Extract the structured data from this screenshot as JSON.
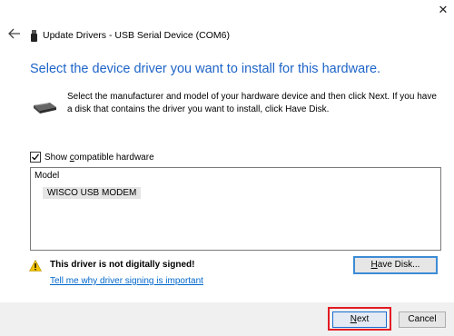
{
  "window": {
    "close_glyph": "✕"
  },
  "header": {
    "back_icon": "back-arrow-icon",
    "device_icon": "usb-plug-icon",
    "title": "Update Drivers - USB Serial Device (COM6)"
  },
  "main": {
    "heading": "Select the device driver you want to install for this hardware.",
    "instruction": "Select the manufacturer and model of your hardware device and then click Next. If you have a disk that contains the driver you want to install, click Have Disk.",
    "show_compatible": {
      "pre": "Show ",
      "mnemonic": "c",
      "post": "ompatible hardware",
      "checked": true
    },
    "model_list": {
      "header": "Model",
      "items": [
        "WISCO USB MODEM"
      ]
    },
    "warning": {
      "text": "This driver is not digitally signed!",
      "link": "Tell me why driver signing is important"
    },
    "have_disk": {
      "mnemonic": "H",
      "rest": "ave Disk..."
    }
  },
  "footer": {
    "next": {
      "mnemonic": "N",
      "rest": "ext"
    },
    "cancel": "Cancel"
  },
  "colors": {
    "heading": "#1e64c8",
    "link": "#0066cc",
    "highlight": "#e31b23"
  }
}
